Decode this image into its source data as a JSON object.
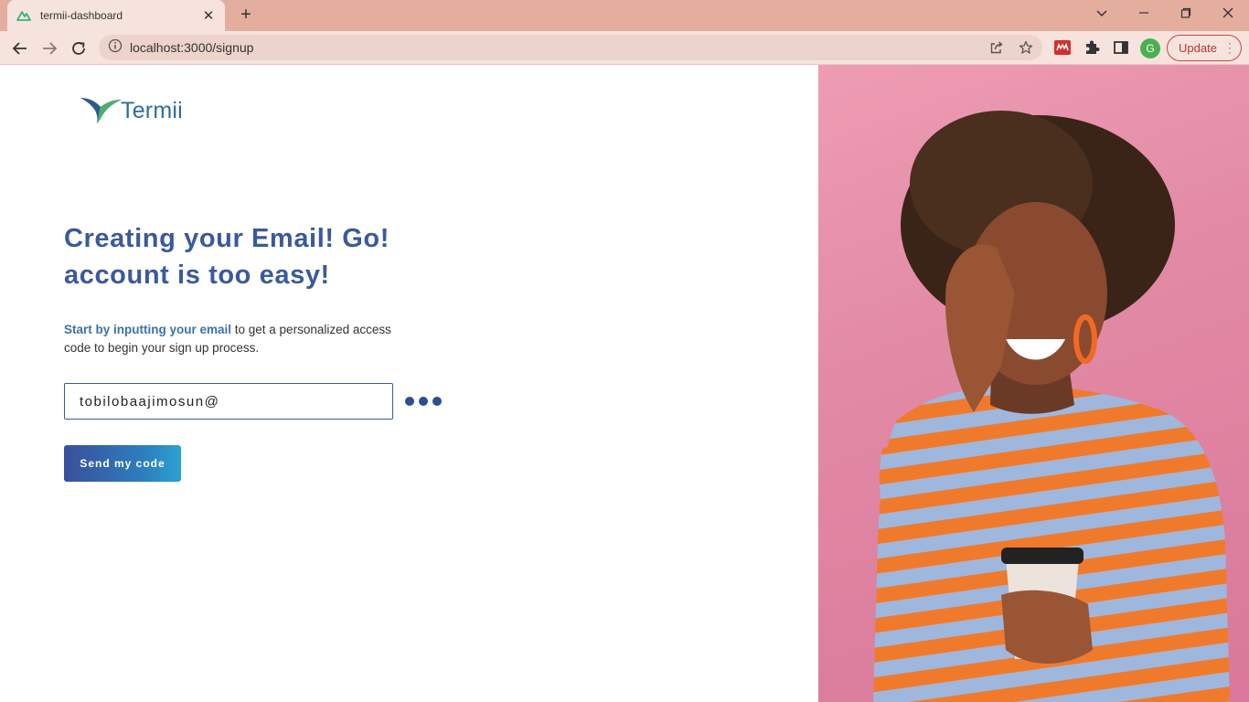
{
  "browser": {
    "tab_title": "termii-dashboard",
    "url": "localhost:3000/signup",
    "profile_initial": "G",
    "update_label": "Update"
  },
  "brand": {
    "name": "Termii"
  },
  "signup": {
    "heading": "Creating your Email! Go! account is too easy!",
    "subtext_highlight": "Start by inputting your email",
    "subtext_rest": " to get a personalized access code to begin your sign up process.",
    "email_value": "tobilobaajimosun@",
    "send_button_label": "Send my code"
  },
  "colors": {
    "accent": "#3a5a9a",
    "tabbar": "#e4ae9f",
    "photo_bg": "#e28aa5"
  }
}
